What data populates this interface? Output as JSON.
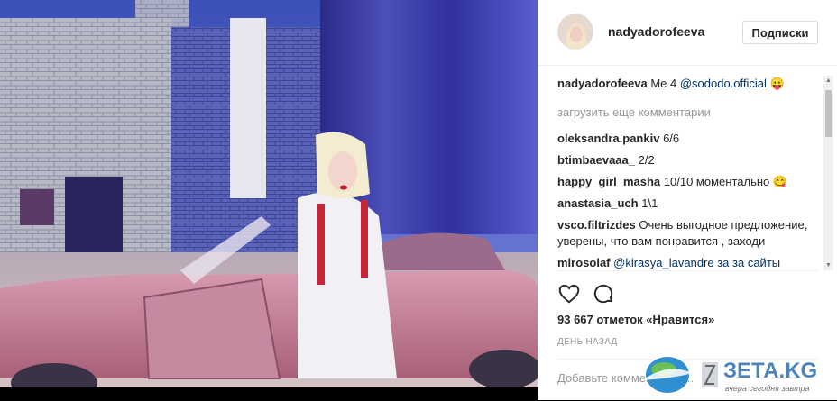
{
  "header": {
    "username": "nadyadorofeeva",
    "follow_label": "Подписки"
  },
  "caption": {
    "username": "nadyadorofeeva",
    "text": "Me 4 ",
    "mention": "@sododo.official",
    "emoji": "tongue-emoji"
  },
  "load_more": "загрузить еще комментарии",
  "comments": [
    {
      "user": "oleksandra.pankiv",
      "text": "6/6"
    },
    {
      "user": "btimbaevaaa_",
      "text": "2/2"
    },
    {
      "user": "happy_girl_masha",
      "text": "10/10 моментально"
    },
    {
      "user": "anastasia_uch",
      "text": "1\\1"
    },
    {
      "user": "vsco.filtrizdes",
      "text": "Очень выгодное предложение, уверены, что вам понравится , заходи"
    },
    {
      "user": "mirosolaf",
      "text": "@kirasya_lavandre за за сайты"
    }
  ],
  "actions": {
    "like_icon": "heart-outline-icon",
    "comment_icon": "speech-bubble-icon"
  },
  "likes": "93 667 отметок «Нравится»",
  "timestamp": "ДЕНЬ НАЗАД",
  "add_comment_placeholder": "Добавьте комментарий...",
  "watermark": {
    "brand": "ЗЕТА.KG",
    "tagline": "вчера сегодня завтра"
  },
  "colors": {
    "text": "#262626",
    "muted": "#999999",
    "mention": "#003569",
    "border": "#dbdbdb"
  }
}
